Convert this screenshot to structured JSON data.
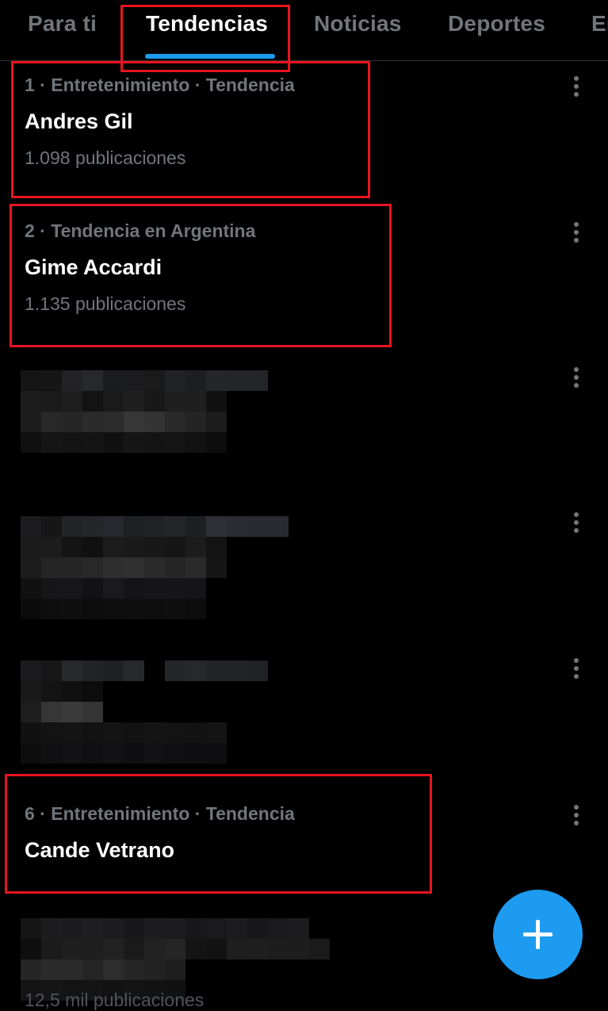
{
  "tabs": [
    {
      "label": "Para ti",
      "active": false
    },
    {
      "label": "Tendencias",
      "active": true
    },
    {
      "label": "Noticias",
      "active": false
    },
    {
      "label": "Deportes",
      "active": false
    },
    {
      "label": "En",
      "active": false
    }
  ],
  "trends": [
    {
      "meta": "1 · Entretenimiento · Tendencia",
      "title": "Andres Gil",
      "count": "1.098 publicaciones"
    },
    {
      "meta": "2 · Tendencia en Argentina",
      "title": "Gime Accardi",
      "count": "1.135 publicaciones"
    },
    {
      "meta": "6 · Entretenimiento · Tendencia",
      "title": "Cande Vetrano"
    }
  ],
  "redacted_trend_count": 4,
  "bottom_partial": "12,5 mil publicaciones",
  "icons": {
    "more": "more-vertical-icon",
    "compose": "plus-icon"
  },
  "colors": {
    "background": "#000000",
    "accent": "#1d9bf0",
    "highlight_box": "#e8141f",
    "muted_text": "#71767b"
  }
}
